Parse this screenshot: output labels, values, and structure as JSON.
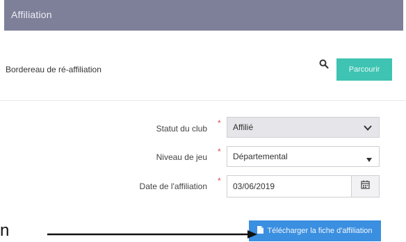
{
  "header": {
    "title": "Affiliation"
  },
  "reaffiliation": {
    "label": "Bordereau de ré-affiliation",
    "browse_label": "Parcourir"
  },
  "form": {
    "statut": {
      "label": "Statut du club",
      "value": "Affilié"
    },
    "niveau": {
      "label": "Niveau de jeu",
      "value": "Départemental"
    },
    "date": {
      "label": "Date de l'affiliation",
      "value": "03/06/2019"
    },
    "required_marker": "*"
  },
  "actions": {
    "download_label": "Télécharger la fiche d'affiliation"
  },
  "annotation": {
    "left_fragment": "n"
  },
  "icons": {
    "search": "search-icon",
    "chevron": "chevron-down-icon",
    "caret": "caret-down-icon",
    "calendar": "calendar-icon",
    "file": "file-icon",
    "arrow": "arrow-right-icon"
  },
  "colors": {
    "header_bg": "#7e7f98",
    "browse_bg": "#3fc3b2",
    "download_bg": "#3b8fe0",
    "required": "#e2474b"
  }
}
